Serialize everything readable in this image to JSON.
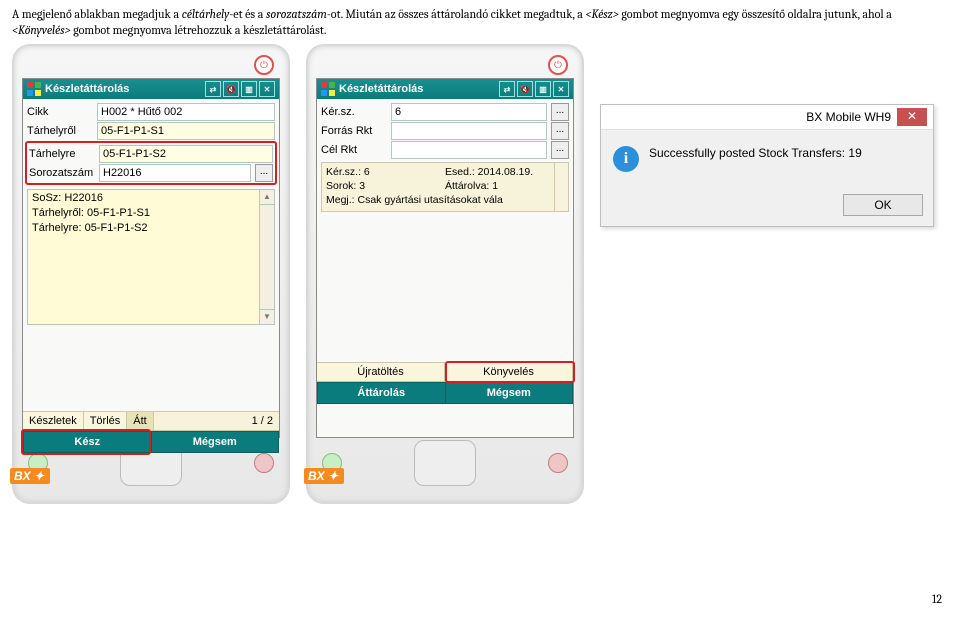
{
  "intro": {
    "part1": "A megjelenő ablakban megadjuk a ",
    "it1": "céltárhely",
    "mid1": "-et és a ",
    "it2": "sorozatszám",
    "mid2": "-ot. Miután az összes áttárolandó cikket megadtuk, a ",
    "it3": "<Kész>",
    "mid3": " gombot megnyomva egy összesítő oldalra jutunk, ahol a ",
    "it4": "<Könyvelés>",
    "end": " gombot megnyomva létrehozzuk a készletáttárolást."
  },
  "screen1": {
    "title": "Készletáttárolás",
    "rows": {
      "cikk_lbl": "Cikk",
      "cikk_val": "H002 * Hűtő 002",
      "trol_lbl": "Tárhelyről",
      "trol_val": "05-F1-P1-S1",
      "tre_lbl": "Tárhelyre",
      "tre_val": "05-F1-P1-S2",
      "ss_lbl": "Sorozatszám",
      "ss_val": "H22016"
    },
    "list": {
      "l1": "SoSz: H22016",
      "l2": "Tárhelyről: 05-F1-P1-S1",
      "l3": "Tárhelyre: 05-F1-P1-S2"
    },
    "mid": {
      "b1": "Készletek",
      "b2": "Törlés",
      "b3": "Átt",
      "cnt": "1 / 2"
    },
    "bot": {
      "b1": "Kész",
      "b2": "Mégsem"
    }
  },
  "screen2": {
    "title": "Készletáttárolás",
    "rows": {
      "r1l": "Kér.sz.",
      "r1v": "6",
      "r2l": "Forrás Rkt",
      "r2v": "",
      "r3l": "Cél Rkt",
      "r3v": ""
    },
    "info": {
      "l1a": "Kér.sz.: 6",
      "l1b": "Esed.: 2014.08.19.",
      "l2a": "Sorok: 3",
      "l2b": "Áttárolva: 1",
      "l3": "Megj.: Csak gyártási utasításokat vála"
    },
    "mid": {
      "b1": "Újratöltés",
      "b2": "Könyvelés"
    },
    "bot": {
      "b1": "Áttárolás",
      "b2": "Mégsem"
    }
  },
  "dialog": {
    "title": "BX Mobile WH9",
    "msg": "Successfully posted Stock Transfers: 19",
    "ok": "OK"
  },
  "bx": "BX",
  "page": "12"
}
